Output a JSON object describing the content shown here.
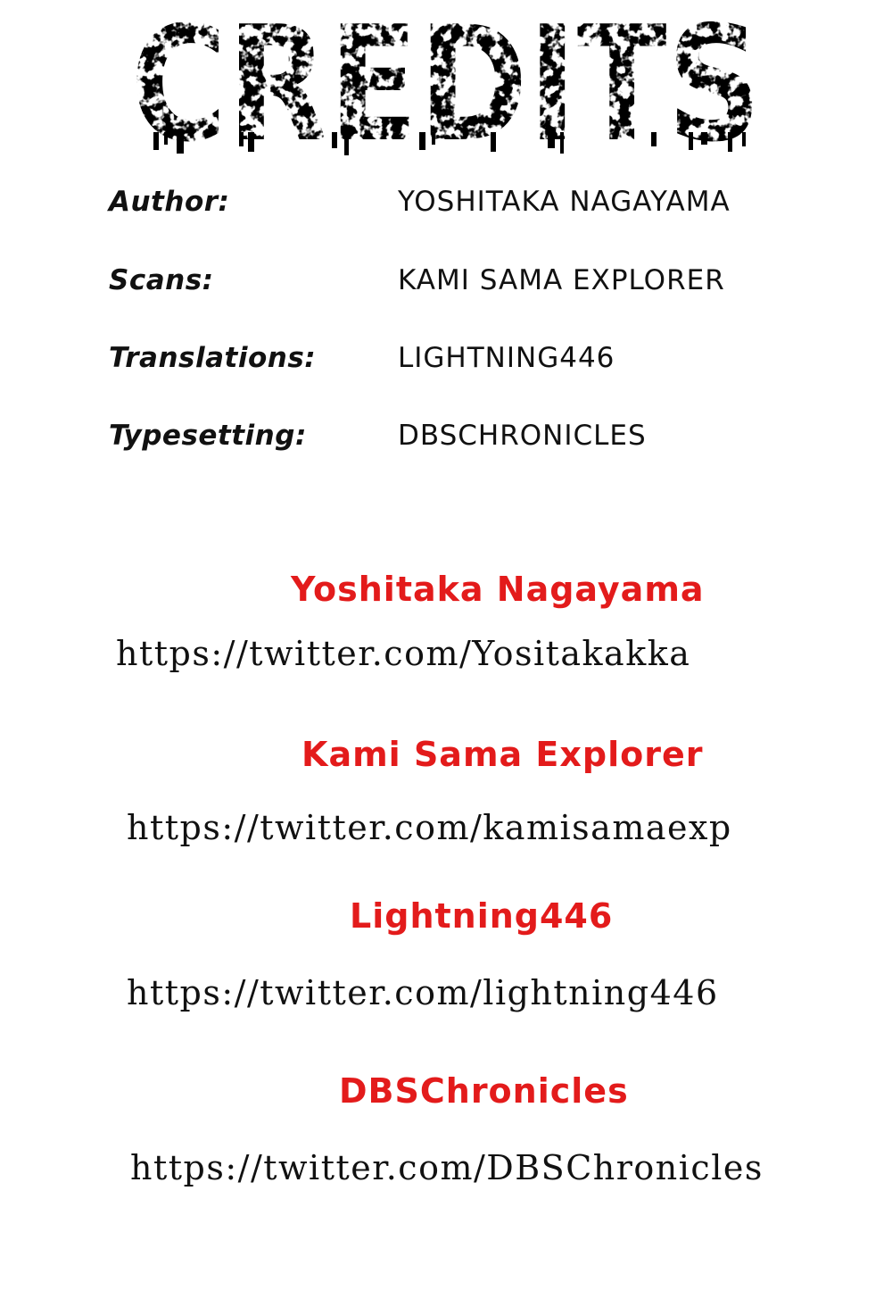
{
  "header": {
    "title": "CREDITS"
  },
  "credits": [
    {
      "label": "Author:",
      "value": "YOSHITAKA NAGAYAMA"
    },
    {
      "label": "Scans:",
      "value": "KAMI SAMA EXPLORER"
    },
    {
      "label": "Translations:",
      "value": "LIGHTNING446"
    },
    {
      "label": "Typesetting:",
      "value": "DBSCHRONICLES"
    }
  ],
  "links": [
    {
      "name": "Yoshitaka Nagayama",
      "url": "https://twitter.com/Yositakakka"
    },
    {
      "name": "Kami Sama Explorer",
      "url": "https://twitter.com/kamisamaexp"
    },
    {
      "name": "Lightning446",
      "url": "https://twitter.com/lightning446"
    },
    {
      "name": "DBSChronicles",
      "url": "https://twitter.com/DBSChronicles"
    }
  ],
  "colors": {
    "name_red": "#e31b1b",
    "text_black": "#111111",
    "background": "#ffffff"
  }
}
